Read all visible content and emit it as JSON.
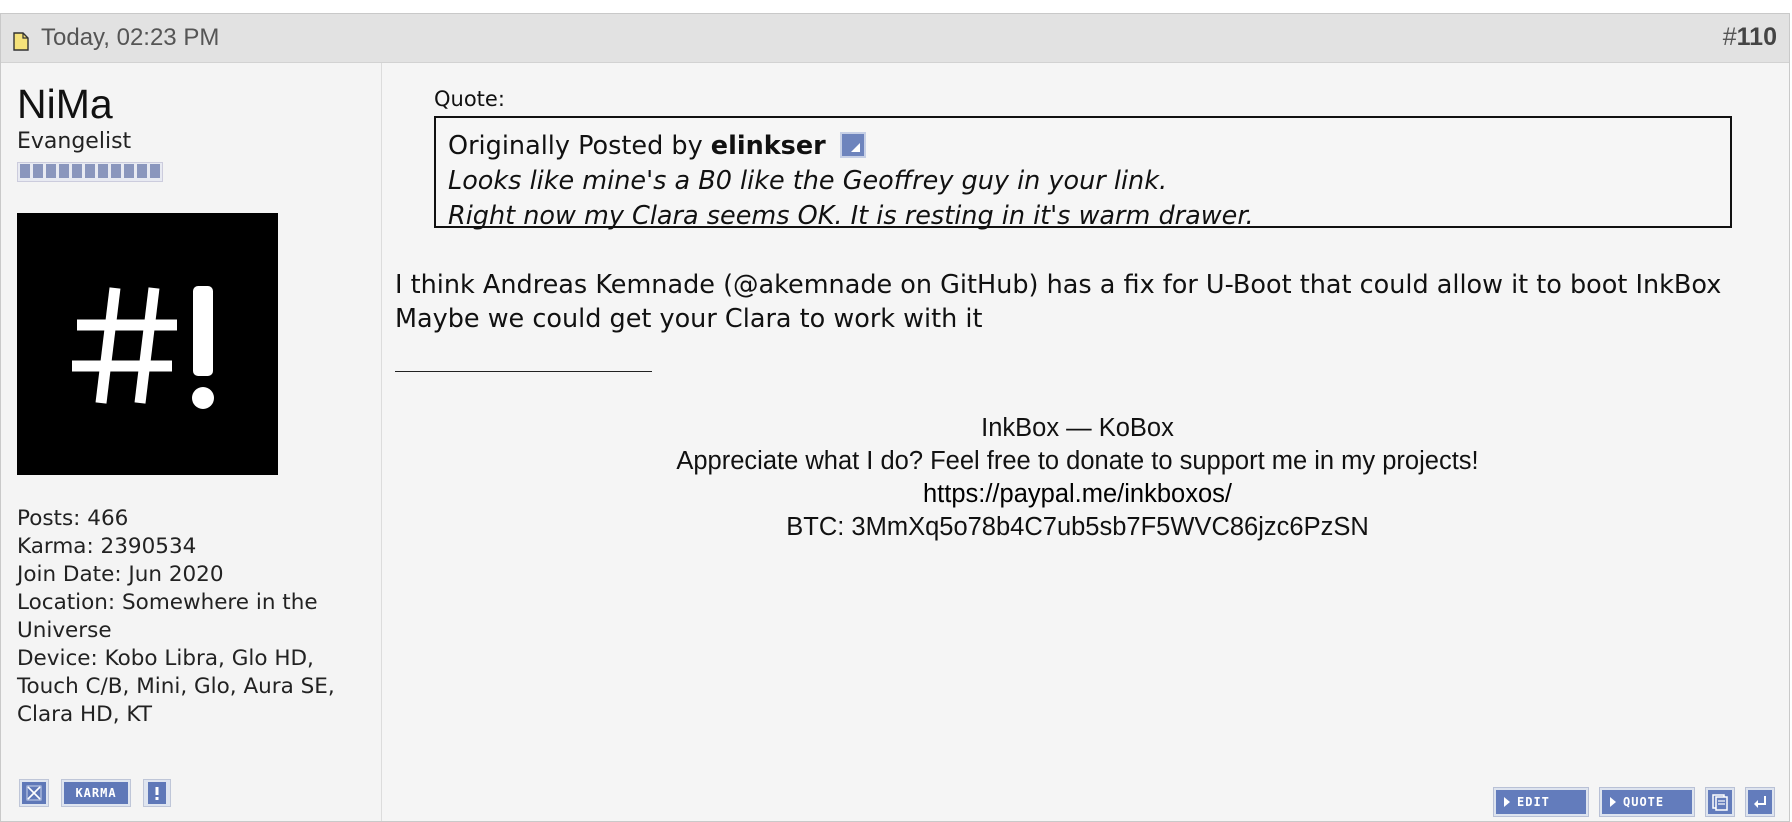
{
  "post": {
    "timestamp": "Today, 02:23 PM",
    "number_prefix": "#",
    "number": "110"
  },
  "user": {
    "name": "NiMa",
    "title": "Evangelist",
    "reputation_pips": 11,
    "avatar_text": "#!",
    "stats": [
      "Posts: 466",
      "Karma: 2390534",
      "Join Date: Jun 2020",
      "Location: Somewhere in the Universe",
      "Device: Kobo Libra, Glo HD, Touch C/B, Mini, Glo, Aura SE, Clara HD, KT"
    ],
    "actions": {
      "karma_label": "KARMA",
      "report_icon": "exclamation-icon",
      "ignore_icon": "x-icon"
    }
  },
  "quote": {
    "label": "Quote:",
    "by_prefix": "Originally Posted by",
    "author": "elinkser",
    "lines": [
      "Looks like mine's a B0 like the Geoffrey guy in your link.",
      "Right now my Clara seems OK. It is resting in it's warm drawer."
    ]
  },
  "body": {
    "line1": "I think Andreas Kemnade (@akemnade on GitHub) has a fix for U-Boot that could allow it to boot InkBox",
    "line2": "Maybe we could get your Clara to work with it"
  },
  "signature": {
    "line1": "InkBox — KoBox",
    "line2": "Appreciate what I do? Feel free to donate to support me in my projects!",
    "link": "https://paypal.me/inkboxos/",
    "btc": "BTC: 3MmXq5o78b4C7ub5sb7F5WVC86jzc6PzSN"
  },
  "actions": {
    "edit_label": "EDIT",
    "quote_label": "QUOTE",
    "multiquote_icon": "multiquote-icon",
    "reply_icon": "reply-icon"
  },
  "colors": {
    "header_bg": "#e2e2e2",
    "button_blue": "#637cbc",
    "post_bg": "#f5f5f5"
  }
}
